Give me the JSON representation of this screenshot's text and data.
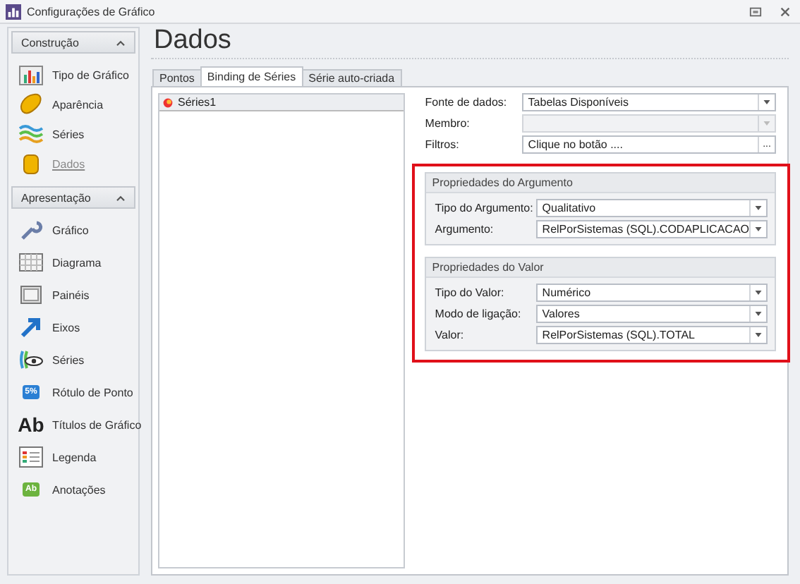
{
  "window": {
    "title": "Configurações de Gráfico"
  },
  "highlight_frame": true,
  "sidebar": {
    "groups": [
      {
        "title": "Construção",
        "expanded": true,
        "items": [
          {
            "label": "Tipo de Gráfico",
            "selected": false
          },
          {
            "label": "Aparência",
            "selected": false
          },
          {
            "label": "Séries",
            "selected": false
          },
          {
            "label": "Dados",
            "selected": true
          }
        ]
      },
      {
        "title": "Apresentação",
        "expanded": true,
        "items": [
          {
            "label": "Gráfico",
            "selected": false
          },
          {
            "label": "Diagrama",
            "selected": false
          },
          {
            "label": "Painéis",
            "selected": false
          },
          {
            "label": "Eixos",
            "selected": false
          },
          {
            "label": "Séries",
            "selected": false
          },
          {
            "label": "Rótulo de Ponto",
            "selected": false,
            "icon_text": "5%"
          },
          {
            "label": "Títulos de Gráfico",
            "selected": false,
            "icon_text": "Ab"
          },
          {
            "label": "Legenda",
            "selected": false
          },
          {
            "label": "Anotações",
            "selected": false,
            "icon_text": "Ab"
          }
        ]
      }
    ]
  },
  "page": {
    "heading": "Dados"
  },
  "tabs": [
    {
      "label": "Pontos",
      "selected": false
    },
    {
      "label": "Binding de Séries",
      "selected": true
    },
    {
      "label": "Série auto-criada",
      "selected": false
    }
  ],
  "series_list": [
    {
      "name": "Séries1",
      "selected": true
    }
  ],
  "fields": [
    {
      "kind": "combo",
      "label": "Fonte de dados:",
      "value": "Tabelas Disponíveis",
      "disabled": false
    },
    {
      "kind": "combo",
      "label": "Membro:",
      "disabled": true
    },
    {
      "kind": "button-edit",
      "label": "Filtros:",
      "value": "Clique no botão ....",
      "button_text": "...",
      "disabled": false
    }
  ],
  "groups": [
    {
      "title": "Propriedades do Argumento",
      "fields": [
        {
          "kind": "combo",
          "label": "Tipo do Argumento:",
          "value": "Qualitativo",
          "disabled": false
        },
        {
          "kind": "combo",
          "label": "Argumento:",
          "value": "RelPorSistemas (SQL).CODAPLICACAO",
          "disabled": false
        }
      ]
    },
    {
      "title": "Propriedades do Valor",
      "fields": [
        {
          "kind": "combo",
          "label": "Tipo do Valor:",
          "value": "Numérico",
          "disabled": false
        },
        {
          "kind": "combo",
          "label": "Modo de ligação:",
          "value": "Valores",
          "disabled": false
        },
        {
          "kind": "combo",
          "label": "Valor:",
          "value": "RelPorSistemas (SQL).TOTAL",
          "disabled": false
        }
      ]
    }
  ]
}
